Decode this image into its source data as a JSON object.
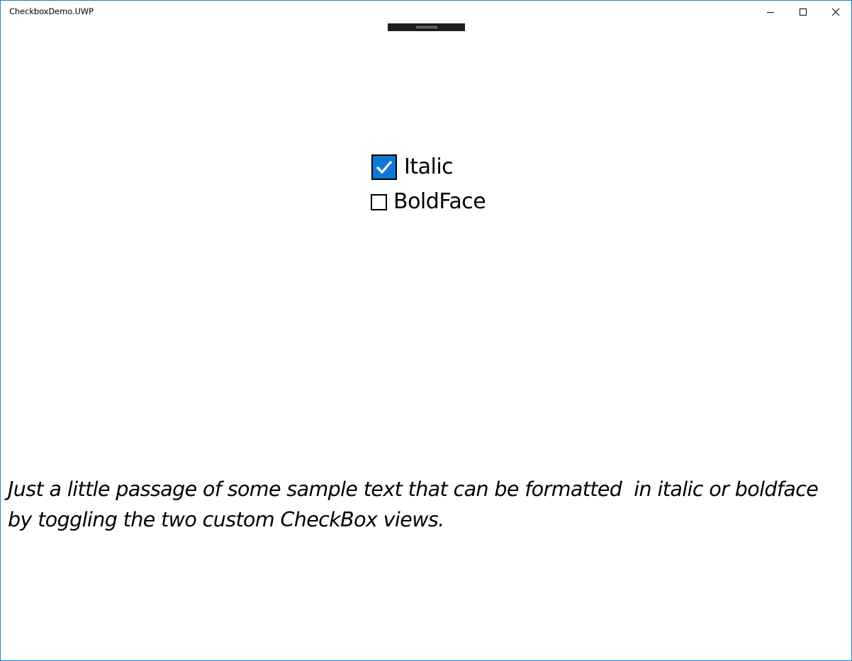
{
  "window": {
    "title": "CheckboxDemo.UWP",
    "border_color": "#1883d7",
    "controls": {
      "minimize_icon": "minimize-icon",
      "maximize_icon": "maximize-icon",
      "close_icon": "close-icon"
    }
  },
  "checkboxes": [
    {
      "label": "Italic",
      "checked": true,
      "accent_color": "#0f78d7"
    },
    {
      "label": "BoldFace",
      "checked": false
    }
  ],
  "passage": {
    "line1": "Just a little passage of some sample text that can be formatted  in italic or boldface",
    "line2": "by toggling the two custom CheckBox views.",
    "italic": true,
    "bold": false
  }
}
